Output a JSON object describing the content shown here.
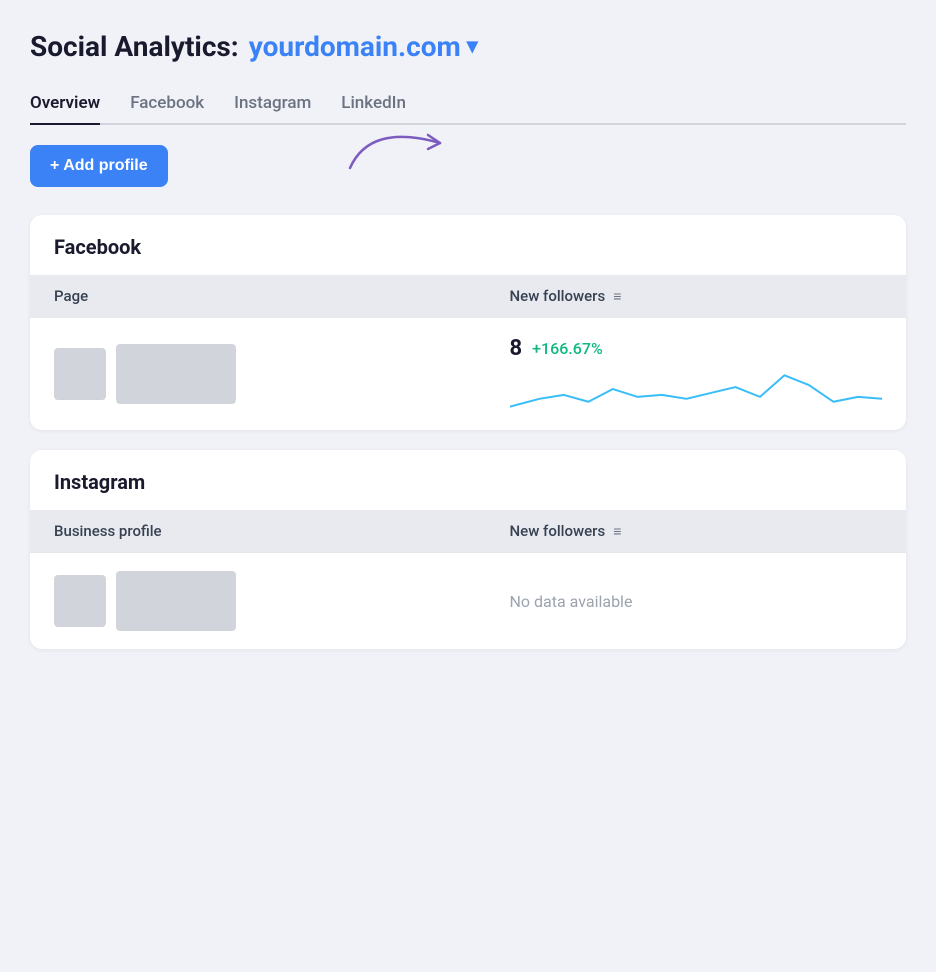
{
  "header": {
    "title_static": "Social Analytics:",
    "domain": "yourdomain.com",
    "chevron": "▾"
  },
  "tabs": [
    {
      "id": "overview",
      "label": "Overview",
      "active": true
    },
    {
      "id": "facebook",
      "label": "Facebook",
      "active": false
    },
    {
      "id": "instagram",
      "label": "Instagram",
      "active": false
    },
    {
      "id": "linkedin",
      "label": "LinkedIn",
      "active": false
    }
  ],
  "add_profile_button": "+ Add profile",
  "cards": [
    {
      "id": "facebook",
      "title": "Facebook",
      "column_page": "Page",
      "column_metric": "New followers",
      "rows": [
        {
          "metric_value": "8",
          "metric_change": "+166.67%",
          "has_data": true
        }
      ]
    },
    {
      "id": "instagram",
      "title": "Instagram",
      "column_page": "Business profile",
      "column_metric": "New followers",
      "rows": [
        {
          "metric_value": null,
          "metric_change": null,
          "has_data": false,
          "no_data_label": "No data available"
        }
      ]
    }
  ]
}
